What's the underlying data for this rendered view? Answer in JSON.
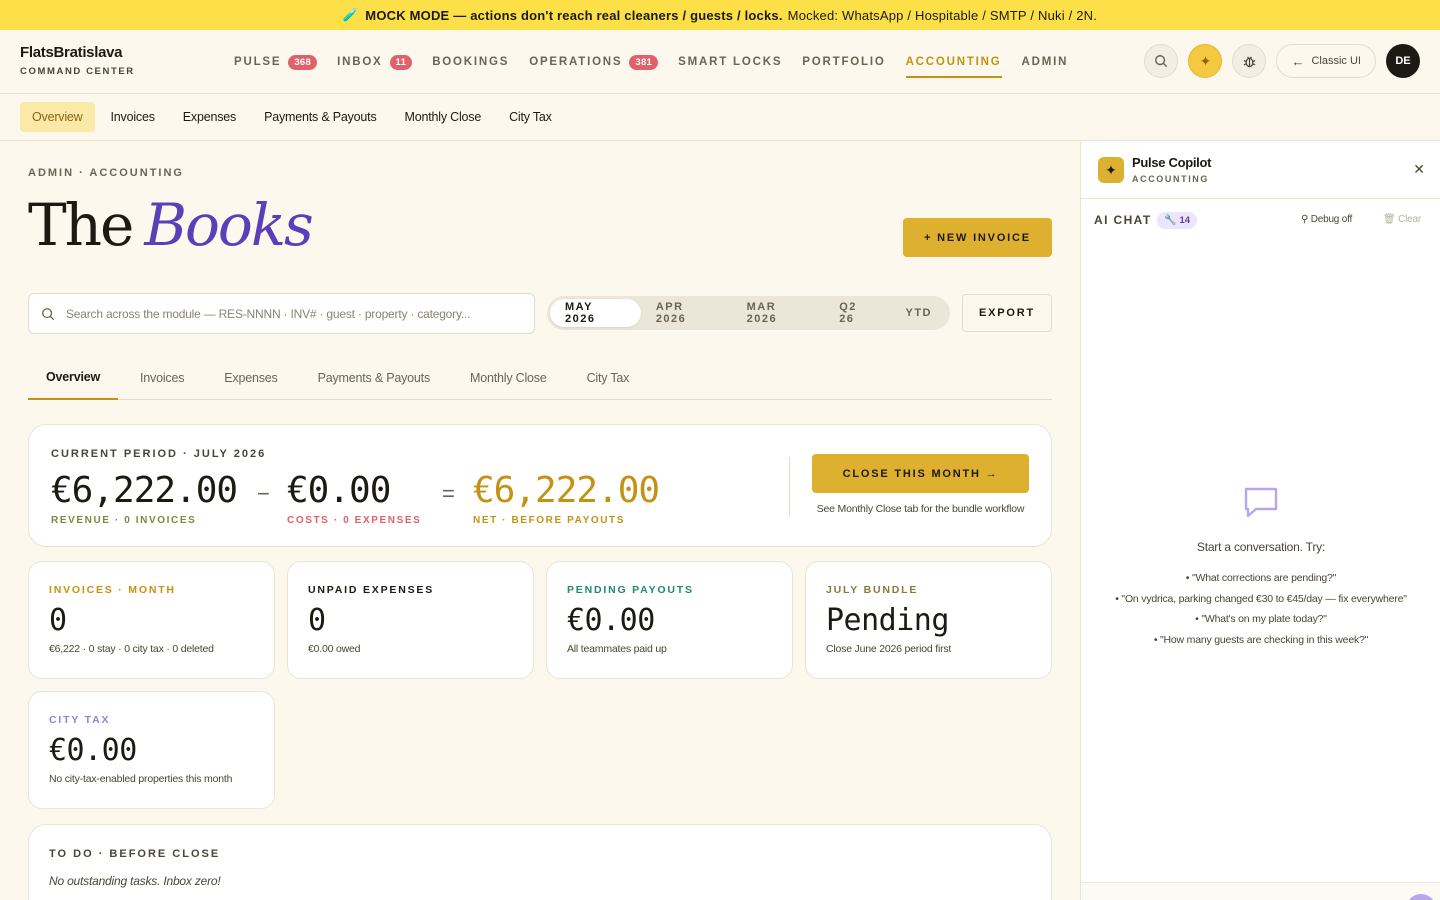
{
  "banner": {
    "bold": "MOCK MODE — actions don't reach real cleaners / guests / locks.",
    "rest": "Mocked: WhatsApp / Hospitable / SMTP / Nuki / 2N."
  },
  "brand": {
    "name": "FlatsBratislava",
    "sub": "COMMAND CENTER"
  },
  "nav": {
    "items": [
      {
        "label": "PULSE",
        "badge": "368"
      },
      {
        "label": "INBOX",
        "badge": "11"
      },
      {
        "label": "BOOKINGS"
      },
      {
        "label": "OPERATIONS",
        "badge": "381"
      },
      {
        "label": "SMART LOCKS"
      },
      {
        "label": "PORTFOLIO"
      },
      {
        "label": "ACCOUNTING"
      },
      {
        "label": "ADMIN"
      }
    ],
    "classic_label": "Classic UI",
    "avatar": "DE"
  },
  "subnav": [
    "Overview",
    "Invoices",
    "Expenses",
    "Payments & Payouts",
    "Monthly Close",
    "City Tax"
  ],
  "header": {
    "crumb": "ADMIN · ACCOUNTING",
    "title_plain": "The",
    "title_accent": "Books",
    "new_invoice": "+ NEW INVOICE"
  },
  "search": {
    "placeholder": "Search across the module — RES-NNNN · INV# · guest · property · category..."
  },
  "periods": [
    "MAY 2026",
    "APR 2026",
    "MAR 2026",
    "Q2 26",
    "YTD"
  ],
  "export_label": "EXPORT",
  "tabs": [
    "Overview",
    "Invoices",
    "Expenses",
    "Payments & Payouts",
    "Monthly Close",
    "City Tax"
  ],
  "summary": {
    "label": "CURRENT PERIOD · JULY 2026",
    "revenue": {
      "amount": "€6,222.00",
      "sub": "REVENUE · 0 INVOICES"
    },
    "minus": "−",
    "costs": {
      "amount": "€0.00",
      "sub": "COSTS · 0 EXPENSES"
    },
    "equals": "=",
    "net": {
      "amount": "€6,222.00",
      "sub": "NET · BEFORE PAYOUTS"
    },
    "close_button": "CLOSE THIS MONTH →",
    "close_note": "See Monthly Close tab for the bundle workflow"
  },
  "stats": [
    {
      "label": "INVOICES · MONTH",
      "value": "0",
      "note": "€6,222 · 0 stay · 0 city tax · 0 deleted",
      "color": "#c49213"
    },
    {
      "label": "UNPAID EXPENSES",
      "value": "0",
      "note": "€0.00 owed",
      "color": "#1d1a14"
    },
    {
      "label": "PENDING PAYOUTS",
      "value": "€0.00",
      "note": "All teammates paid up",
      "color": "#1f8a6e"
    },
    {
      "label": "JULY BUNDLE",
      "value": "Pending",
      "note": "Close June 2026 period first",
      "color": "#8a7a3c"
    },
    {
      "label": "CITY TAX",
      "value": "€0.00",
      "note": "No city-tax-enabled properties this month",
      "color": "#8f86d6"
    }
  ],
  "todo": {
    "label": "TO DO · BEFORE CLOSE",
    "note": "No outstanding tasks. Inbox zero!"
  },
  "copilot": {
    "title": "Pulse Copilot",
    "sub": "ACCOUNTING",
    "chat_label": "AI CHAT",
    "tool_count": "14",
    "debug": "Debug off",
    "clear": "Clear",
    "start": "Start a conversation. Try:",
    "suggestions": [
      "• \"What corrections are pending?\"",
      "• \"On vydrica, parking changed €30 to €45/day — fix everywhere\"",
      "• \"What's on my plate today?\"",
      "• \"How many guests are checking in this week?\""
    ]
  },
  "colors": {
    "accent_gold": "#c49213",
    "button_gold": "#ddb02f",
    "title_purple": "#5b3fb8",
    "revenue_green": "#7a8a3c",
    "cost_red": "#e0616a",
    "banner_yellow": "#fde047"
  },
  "icons": {
    "banner": "flask-icon",
    "search": "search-icon",
    "ai": "sparkle-icon",
    "debug": "bug-icon",
    "classic": "arrow-left-icon",
    "close": "close-icon",
    "chat": "chat-bubble-icon",
    "tools": "wrench-icon",
    "trash": "trash-icon"
  }
}
